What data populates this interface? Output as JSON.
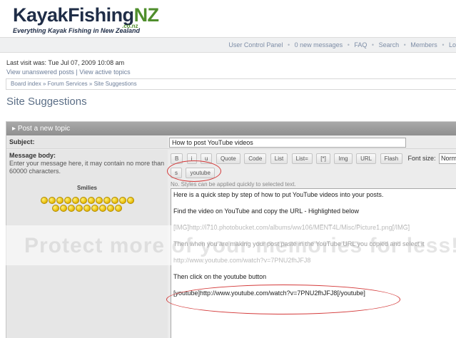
{
  "header": {
    "logo_main": "KayakFishing",
    "logo_nz": "NZ",
    "logo_domain": ".co.nz",
    "tagline": "Everything Kayak Fishing in New Zealand"
  },
  "navbar": {
    "items": [
      "User Control Panel",
      "0 new messages",
      "FAQ",
      "Search",
      "Members",
      "Lo"
    ],
    "separator": "•"
  },
  "visit": {
    "last_visit": "Last visit was: Tue Jul 07, 2009 10:08 am",
    "unanswered": "View unanswered posts",
    "divider": "|",
    "active": "View active topics"
  },
  "breadcrumb": {
    "items": [
      "Board index",
      "Forum Services",
      "Site Suggestions"
    ],
    "separator": "»"
  },
  "page_title": "Site Suggestions",
  "post_panel": {
    "header": "Post a new topic",
    "subject_label": "Subject:",
    "subject_value": "How to post YouTube videos",
    "body_label": "Message body:",
    "body_hint": "Enter your message here, it may contain no more than 60000 characters.",
    "smilies_title": "Smilies",
    "toolbar": [
      "B",
      "i",
      "u",
      "Quote",
      "Code",
      "List",
      "List=",
      "[*]",
      "Img",
      "URL",
      "Flash"
    ],
    "font_size_label": "Font size:",
    "font_size_value": "Norm",
    "toolbar2": [
      "s",
      "youtube"
    ],
    "style_hint": "No. Styles can be applied quickly to selected text.",
    "message_lines": [
      "Here is a quick step by step of how to put YouTube videos into your posts.",
      "Find the video on YouTube and copy the URL - Highlighted below",
      "[IMG]http://i710.photobucket.com/albums/ww106/MENT4L/Misc/Picture1.png[/IMG]",
      "Then when you are making your post paste in the YouTube URL you copied and select it",
      "http://www.youtube.com/watch?v=7PNU2fhJFJ8",
      "Then click on the youtube button",
      "[youtube]http://www.youtube.com/watch?v=7PNU2fhJFJ8[/youtube]"
    ]
  },
  "watermark": "Protect more of your memories for less!",
  "colors": {
    "annotation_circle": "#d43a3a",
    "header_bar": "#999999",
    "link": "#6e7f9a"
  }
}
